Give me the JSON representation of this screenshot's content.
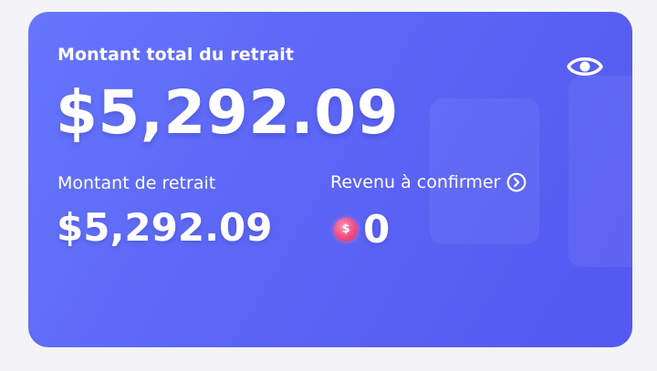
{
  "card": {
    "title": "Montant total du retrait",
    "total_amount": "$5,292.09",
    "visibility_icon": "eye-icon",
    "withdrawal": {
      "label": "Montant de retrait",
      "amount": "$5,292.09"
    },
    "pending": {
      "label": "Revenu à confirmer",
      "link_icon": "chevron-right-circle-icon",
      "coin_icon": "coin-dollar-icon",
      "coin_symbol": "$",
      "amount": "0"
    },
    "colors": {
      "card_start": "#6676fb",
      "card_end": "#5358f0",
      "coin": "#f04a83"
    }
  }
}
